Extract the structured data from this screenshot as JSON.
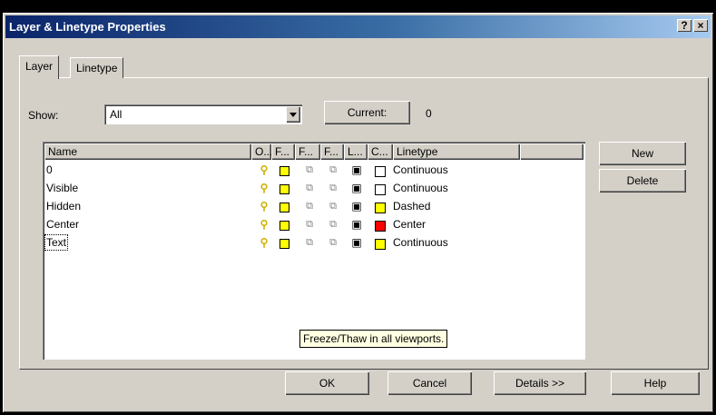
{
  "window": {
    "title": "Layer & Linetype Properties",
    "help_button": "?",
    "close_button": "×"
  },
  "tabs": [
    {
      "label": "Layer",
      "active": true
    },
    {
      "label": "Linetype",
      "active": false
    }
  ],
  "show": {
    "label": "Show:",
    "value": "All"
  },
  "current": {
    "button": "Current:",
    "value": "0"
  },
  "columns": [
    "Name",
    "O...",
    "F...",
    "F...",
    "F...",
    "L...",
    "C...",
    "Linetype"
  ],
  "layers": [
    {
      "name": "0",
      "color": "#ffffff",
      "linetype": "Continuous"
    },
    {
      "name": "Visible",
      "color": "#ffffff",
      "linetype": "Continuous"
    },
    {
      "name": "Hidden",
      "color": "#ffff00",
      "linetype": "Dashed"
    },
    {
      "name": "Center",
      "color": "#ff0000",
      "linetype": "Center"
    },
    {
      "name": "Text",
      "color": "#ffff00",
      "linetype": "Continuous"
    }
  ],
  "side_buttons": {
    "new": "New",
    "delete": "Delete"
  },
  "tooltip": "Freeze/Thaw in all viewports.",
  "footer": {
    "ok": "OK",
    "cancel": "Cancel",
    "details": "Details >>",
    "help": "Help"
  },
  "icons": {
    "on": "lightbulb-icon",
    "freeze": "sun-icon",
    "vp_freeze": "viewport-freeze-icon",
    "new_vp": "new-viewport-freeze-icon",
    "lock": "unlocked-padlock-icon"
  }
}
